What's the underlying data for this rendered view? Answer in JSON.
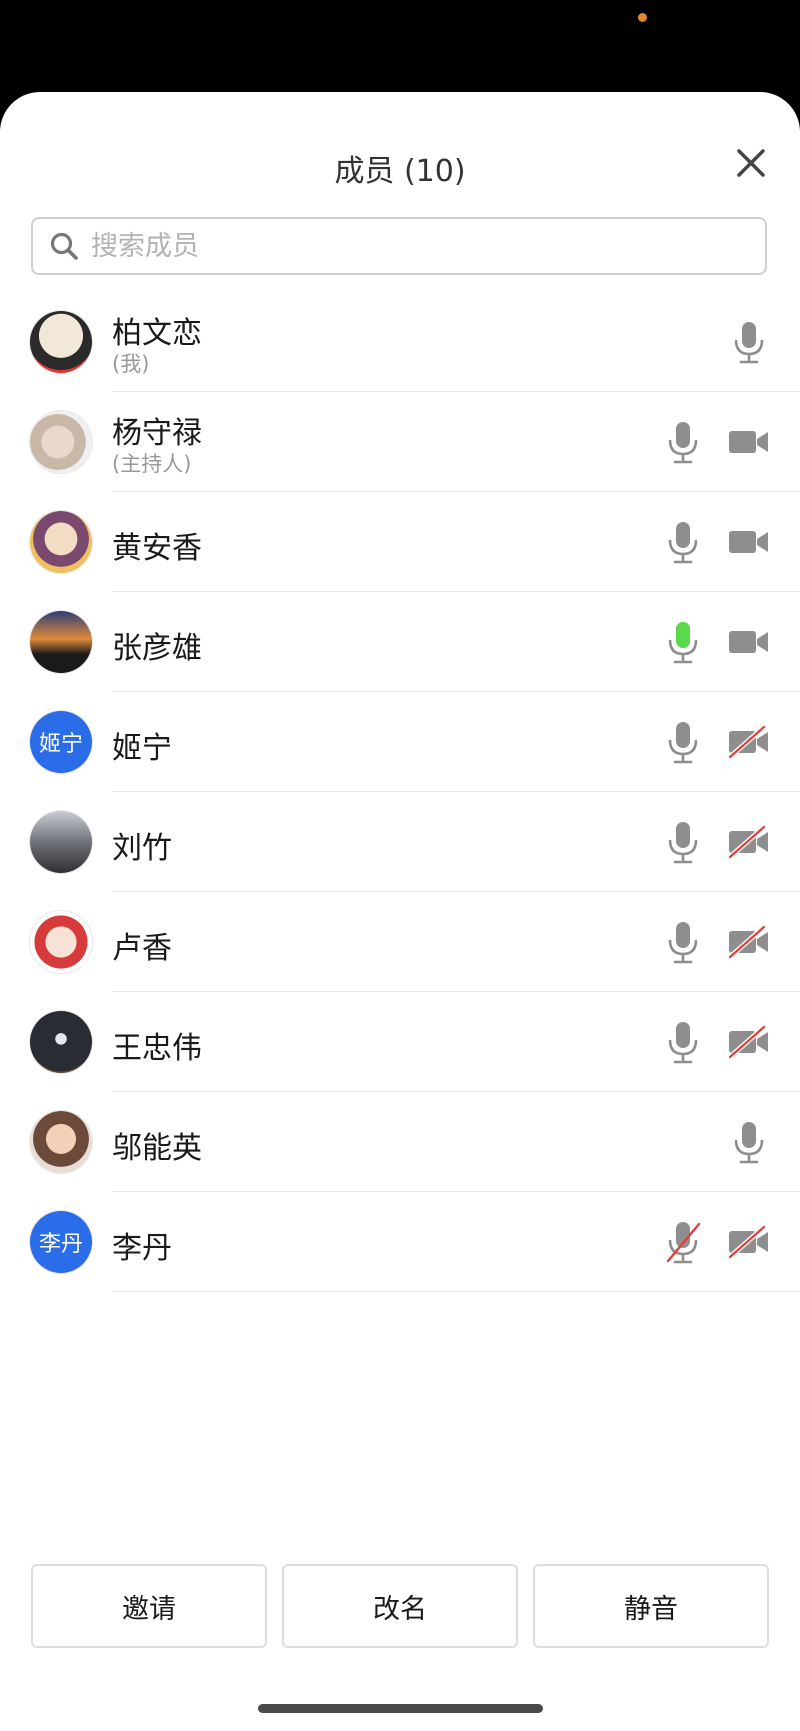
{
  "header": {
    "title": "成员 (10)"
  },
  "search": {
    "placeholder": "搜索成员"
  },
  "members": [
    {
      "name": "柏文恋",
      "tag": "(我)",
      "mic": "normal",
      "camera": "none",
      "avatar_text": ""
    },
    {
      "name": "杨守禄",
      "tag": "(主持人)",
      "mic": "normal",
      "camera": "on",
      "avatar_text": ""
    },
    {
      "name": "黄安香",
      "tag": "",
      "mic": "normal",
      "camera": "on",
      "avatar_text": ""
    },
    {
      "name": "张彦雄",
      "tag": "",
      "mic": "speaking",
      "camera": "on",
      "avatar_text": ""
    },
    {
      "name": "姬宁",
      "tag": "",
      "mic": "normal",
      "camera": "off",
      "avatar_text": "姬宁"
    },
    {
      "name": "刘竹",
      "tag": "",
      "mic": "normal",
      "camera": "off",
      "avatar_text": ""
    },
    {
      "name": "卢香",
      "tag": "",
      "mic": "normal",
      "camera": "off",
      "avatar_text": ""
    },
    {
      "name": "王忠伟",
      "tag": "",
      "mic": "normal",
      "camera": "off",
      "avatar_text": ""
    },
    {
      "name": "邬能英",
      "tag": "",
      "mic": "normal",
      "camera": "none",
      "avatar_text": ""
    },
    {
      "name": "李丹",
      "tag": "",
      "mic": "muted",
      "camera": "off",
      "avatar_text": "李丹"
    }
  ],
  "buttons": {
    "invite": "邀请",
    "rename": "改名",
    "mute": "静音"
  },
  "colors": {
    "accent_blue": "#2b6de8",
    "mic_gray": "#8e8e8e",
    "speaking_green": "#5ad94a",
    "off_red": "#e0403a"
  }
}
